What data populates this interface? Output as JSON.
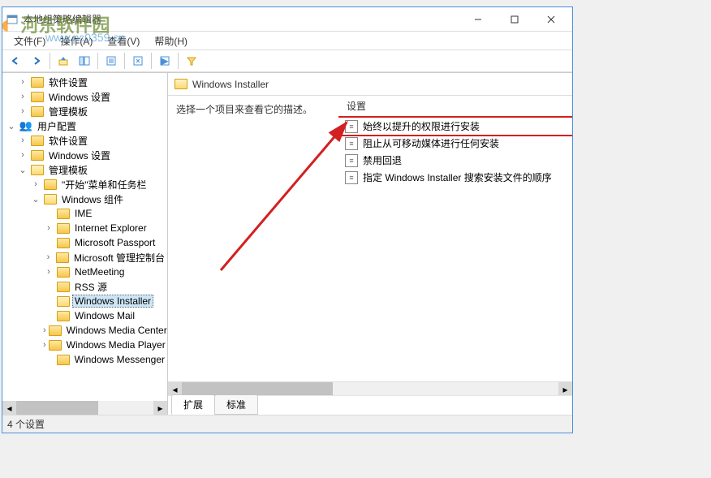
{
  "window": {
    "title": "本地组策略编辑器"
  },
  "menu": {
    "file": "文件(F)",
    "action": "操作(A)",
    "view": "查看(V)",
    "help": "帮助(H)"
  },
  "tree": {
    "node_soft_settings": "软件设置",
    "node_win_settings": "Windows 设置",
    "node_admin_tmpl": "管理模板",
    "node_user_config": "用户配置",
    "node_start_taskbar": "\"开始\"菜单和任务栏",
    "node_win_components": "Windows 组件",
    "node_ime": "IME",
    "node_ie": "Internet Explorer",
    "node_ms_passport": "Microsoft Passport",
    "node_ms_mgmt": "Microsoft 管理控制台",
    "node_netmeeting": "NetMeeting",
    "node_rss": "RSS 源",
    "node_win_installer": "Windows Installer",
    "node_win_mail": "Windows Mail",
    "node_wmc": "Windows Media Center",
    "node_wmp": "Windows Media Player",
    "node_messenger": "Windows Messenger"
  },
  "content": {
    "header": "Windows Installer",
    "desc_prompt": "选择一个项目来查看它的描述。",
    "col_setting": "设置",
    "items": [
      "始终以提升的权限进行安装",
      "阻止从可移动媒体进行任何安装",
      "禁用回退",
      "指定 Windows Installer 搜索安装文件的顺序"
    ]
  },
  "tabs": {
    "extended": "扩展",
    "standard": "标准"
  },
  "status": {
    "text": "4 个设置"
  },
  "watermark": {
    "text": "河东软件园",
    "url": "www.pc0359.cn"
  }
}
